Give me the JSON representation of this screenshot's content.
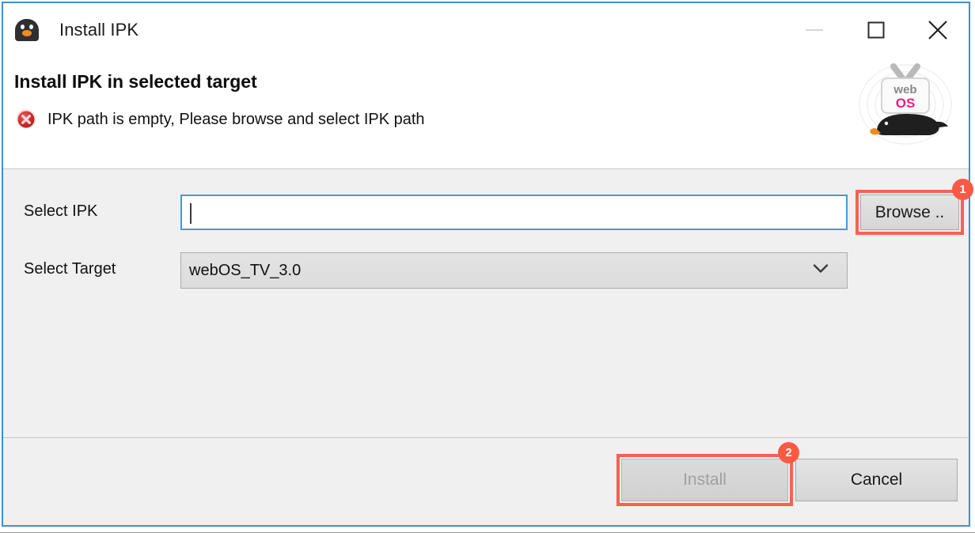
{
  "window": {
    "title": "Install IPK",
    "app_icon": "penguin-icon",
    "border_color": "#3f8fd2",
    "controls": [
      {
        "name": "minimize",
        "glyph": "minimize-icon",
        "enabled": false
      },
      {
        "name": "maximize",
        "glyph": "maximize-icon",
        "enabled": true
      },
      {
        "name": "close",
        "glyph": "close-icon",
        "enabled": true
      }
    ]
  },
  "header": {
    "title": "Install IPK in selected target",
    "status_icon": "error-icon",
    "status_message": "IPK path is empty, Please browse and select IPK path",
    "logo": {
      "name": "webos-logo",
      "line1": "web",
      "line2": "OS",
      "line1_color": "#8a8a8a",
      "line2_color": "#ec1e79"
    }
  },
  "form": {
    "ipk": {
      "label": "Select IPK",
      "value": "",
      "placeholder": "",
      "focused": true,
      "browse_button": "Browse .."
    },
    "target": {
      "label": "Select Target",
      "selected": "webOS_TV_3.0",
      "options": [
        "webOS_TV_3.0"
      ],
      "arrow_icon": "chevron-down-icon"
    }
  },
  "footer": {
    "install_label": "Install",
    "install_enabled": false,
    "cancel_label": "Cancel",
    "cancel_enabled": true
  },
  "annotations": {
    "color": "#fa5a44",
    "items": [
      {
        "number": "1",
        "target": "browse-button"
      },
      {
        "number": "2",
        "target": "install-button"
      }
    ]
  }
}
